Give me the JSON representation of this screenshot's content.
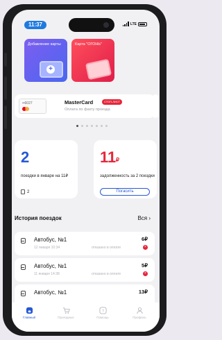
{
  "status_bar": {
    "time": "11:37",
    "network": "LTE"
  },
  "cards": [
    {
      "label": "Добавление карты"
    },
    {
      "label": "Карта \"ОГОНЬ\""
    }
  ],
  "payment_card": {
    "number": "••6027",
    "title": "MasterCard",
    "stop_badge": "СТОП-ЛИСТ",
    "subtitle": "Оплата по факту проезда"
  },
  "stats": {
    "trips_count": "2",
    "trips_desc": "поездки в январе на 11₽",
    "trips_chip": "2",
    "debt_amount": "11",
    "debt_currency": "₽",
    "debt_desc": "задолженность за 2 поездки",
    "pay_button": "Погасить"
  },
  "history": {
    "title": "История поездок",
    "all": "Вся  ›",
    "trips": [
      {
        "route": "Автобус, №1",
        "date": "12 января 10:34",
        "status": "отказано в оплате",
        "price": "6₽"
      },
      {
        "route": "Автобус, №1",
        "date": "11 января 14:38",
        "status": "отказано в оплате",
        "price": "5₽"
      },
      {
        "route": "Автобус, №1",
        "date": "",
        "status": "",
        "price": "13₽"
      }
    ]
  },
  "tabbar": [
    {
      "label": "Главный",
      "icon": "home-icon"
    },
    {
      "label": "Проездные",
      "icon": "cart-icon"
    },
    {
      "label": "Помощь",
      "icon": "help-icon"
    },
    {
      "label": "Профиль",
      "icon": "profile-icon"
    }
  ],
  "colors": {
    "accent": "#2559d6",
    "danger": "#e5263a",
    "card_purple": "#6a5cf0",
    "card_red": "#f0324f"
  }
}
